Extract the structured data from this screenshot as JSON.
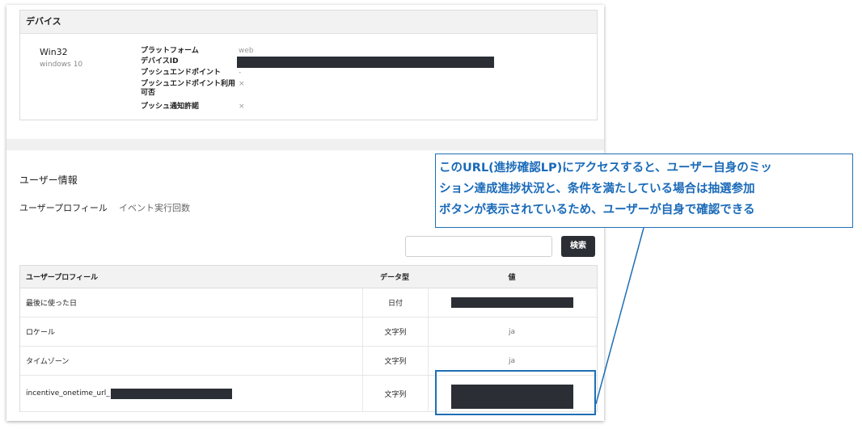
{
  "device": {
    "section_label": "デバイス",
    "name": "Win32",
    "os": "windows 10",
    "labels": [
      "プラットフォーム",
      "デバイスID",
      "プッシュエンドポイント",
      "プッシュエンドポイント利用可否",
      "プッシュ通知許諾"
    ],
    "platform_value": "web",
    "push_endpoint_value": "-",
    "push_usable_value": "×",
    "push_permission_value": "×"
  },
  "user_info": {
    "title": "ユーザー情報",
    "tabs": [
      "ユーザープロフィール",
      "イベント実行回数"
    ],
    "search_placeholder": "",
    "search_button": "検索",
    "table": {
      "headers": [
        "ユーザープロフィール",
        "データ型",
        "値"
      ],
      "rows": [
        {
          "name": "最後に使った日",
          "type": "日付",
          "value": ""
        },
        {
          "name": "ロケール",
          "type": "文字列",
          "value": "ja"
        },
        {
          "name": "タイムゾーン",
          "type": "文字列",
          "value": "ja"
        },
        {
          "name": "incentive_onetime_url_",
          "type": "文字列",
          "value": ""
        }
      ]
    }
  },
  "annotation": {
    "lines": [
      "このURL(進捗確認LP)にアクセスすると、ユーザー自身のミッ",
      "ション達成進捗状況と、条件を満たしている場合は抽選参加",
      "ボタンが表示されているため、ユーザーが自身で確認できる"
    ],
    "color": "#1f6fb5"
  },
  "colors": {
    "redaction": "#2b2e34",
    "accent": "#1f6fb5"
  }
}
